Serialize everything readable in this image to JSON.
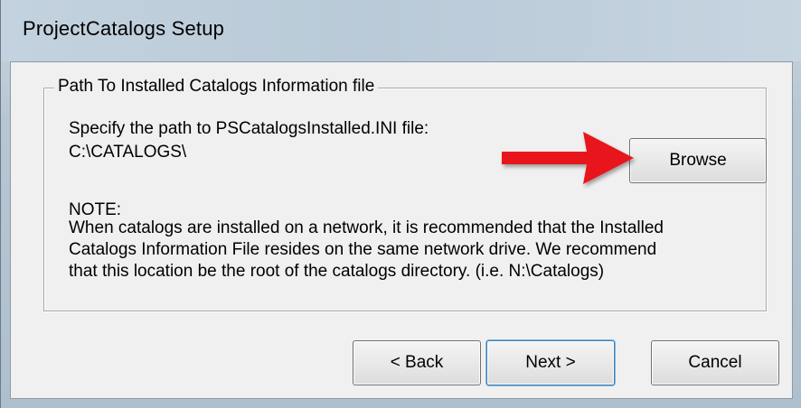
{
  "window": {
    "title": "ProjectCatalogs Setup"
  },
  "group": {
    "legend": "Path To Installed Catalogs Information file",
    "prompt": "Specify the path to PSCatalogsInstalled.INI file:",
    "path_value": "C:\\CATALOGS\\",
    "browse_label": "Browse",
    "note_heading": "NOTE:",
    "note_lines": [
      "When catalogs are installed on a network, it is recommended that the Installed",
      "Catalogs Information File resides on the same network drive.  We recommend",
      "that this location be the root of the catalogs directory. (i.e. N:\\Catalogs)"
    ]
  },
  "buttons": {
    "back": "< Back",
    "next": "Next >",
    "cancel": "Cancel"
  },
  "colors": {
    "annotation_arrow": "#e8141a",
    "dialog_bg": "#f0f0f0",
    "title_bar": "#b9cad8"
  },
  "icons": {
    "annotation": "red-arrow-icon"
  }
}
